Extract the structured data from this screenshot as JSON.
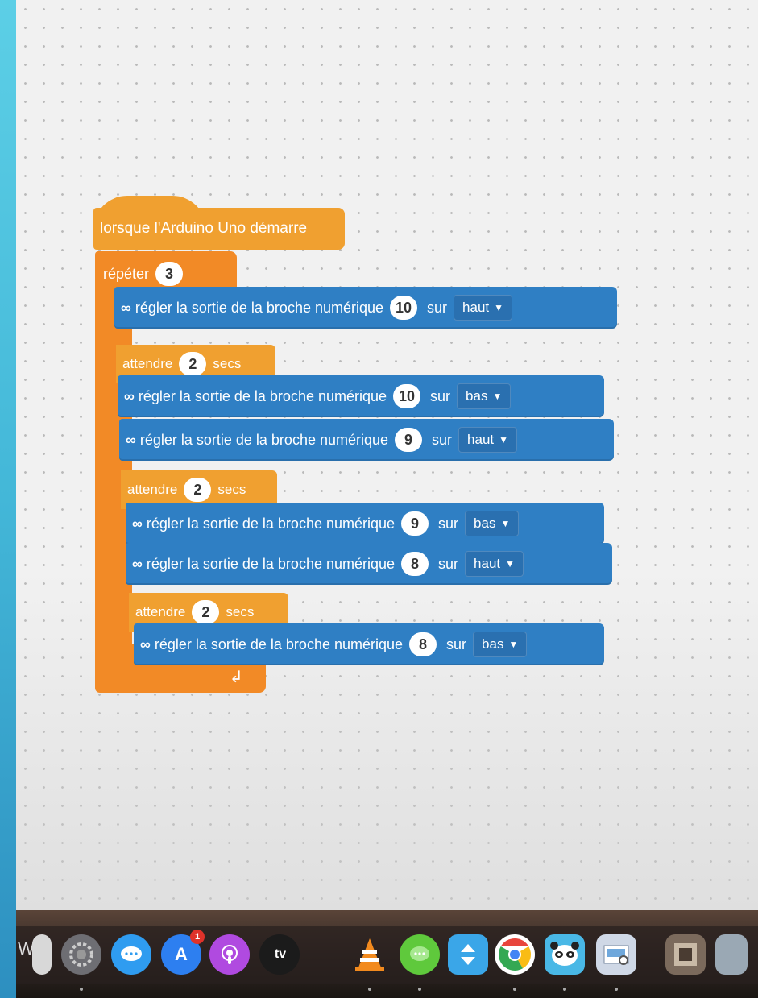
{
  "hat": {
    "label": "lorsque l'Arduino Uno démarre"
  },
  "repeat": {
    "label": "répéter",
    "count": "3",
    "loop_icon": "↲"
  },
  "blocks": [
    {
      "type": "pin",
      "label": "régler la sortie de la broche numérique",
      "pin": "10",
      "sur": "sur",
      "state": "haut"
    },
    {
      "type": "wait",
      "label": "attendre",
      "value": "2",
      "unit": "secs"
    },
    {
      "type": "pin",
      "label": "régler la sortie de la broche numérique",
      "pin": "10",
      "sur": "sur",
      "state": "bas"
    },
    {
      "type": "pin",
      "label": "régler la sortie de la broche numérique",
      "pin": "9",
      "sur": "sur",
      "state": "haut"
    },
    {
      "type": "wait",
      "label": "attendre",
      "value": "2",
      "unit": "secs"
    },
    {
      "type": "pin",
      "label": "régler la sortie de la broche numérique",
      "pin": "9",
      "sur": "sur",
      "state": "bas"
    },
    {
      "type": "pin",
      "label": "régler la sortie de la broche numérique",
      "pin": "8",
      "sur": "sur",
      "state": "haut"
    },
    {
      "type": "wait",
      "label": "attendre",
      "value": "2",
      "unit": "secs"
    },
    {
      "type": "pin",
      "label": "régler la sortie de la broche numérique",
      "pin": "8",
      "sur": "sur",
      "state": "bas"
    }
  ],
  "arduino_icon": "∞",
  "dock": {
    "partial_label": "W",
    "apps": [
      {
        "name": "system-preferences-icon"
      },
      {
        "name": "messages-icon"
      },
      {
        "name": "app-store-icon",
        "badge": "1"
      },
      {
        "name": "podcasts-icon"
      },
      {
        "name": "apple-tv-icon",
        "label": "tv"
      },
      {
        "name": "vlc-icon"
      },
      {
        "name": "chat-icon"
      },
      {
        "name": "migration-icon"
      },
      {
        "name": "chrome-icon"
      },
      {
        "name": "mblock-panda-icon"
      },
      {
        "name": "preview-icon"
      },
      {
        "name": "photo-app-icon"
      }
    ]
  },
  "colors": {
    "events": "#f0a030",
    "control": "#f28a26",
    "arduino": "#2f7fc4",
    "dropdown": "#2a70b0",
    "workspace": "#f1f1f1"
  }
}
